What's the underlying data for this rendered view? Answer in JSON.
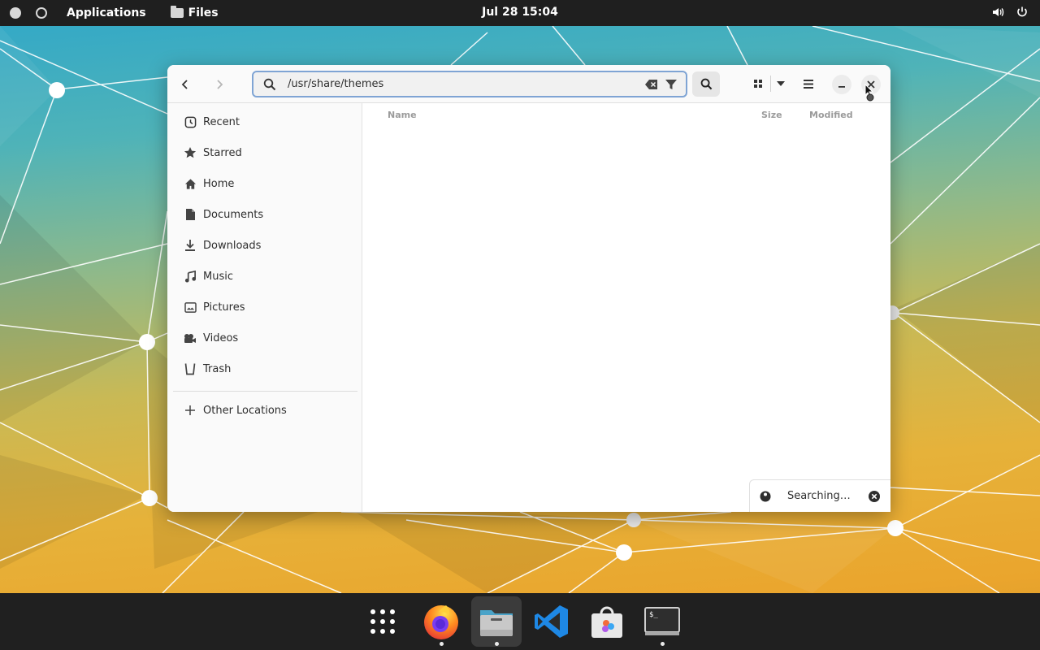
{
  "topbar": {
    "applications_label": "Applications",
    "active_app_label": "Files",
    "clock": "Jul 28  15:04",
    "volume_icon": "speaker-icon",
    "power_icon": "power-icon"
  },
  "window": {
    "location_path": "/usr/share/themes",
    "columns": {
      "name": "Name",
      "size": "Size",
      "modified": "Modified"
    },
    "toast": {
      "text": "Searching…"
    }
  },
  "sidebar": {
    "items": [
      {
        "label": "Recent",
        "icon": "clock-icon"
      },
      {
        "label": "Starred",
        "icon": "star-icon"
      },
      {
        "label": "Home",
        "icon": "home-icon"
      },
      {
        "label": "Documents",
        "icon": "document-icon"
      },
      {
        "label": "Downloads",
        "icon": "download-icon"
      },
      {
        "label": "Music",
        "icon": "music-icon"
      },
      {
        "label": "Pictures",
        "icon": "picture-icon"
      },
      {
        "label": "Videos",
        "icon": "video-icon"
      },
      {
        "label": "Trash",
        "icon": "trash-icon"
      }
    ],
    "other_locations": "Other Locations"
  },
  "dock": {
    "items": [
      "app-grid",
      "firefox",
      "files",
      "vscode",
      "software-store",
      "terminal"
    ]
  },
  "colors": {
    "topbar_bg": "#1f1f1f",
    "dock_bg": "#202020",
    "focus_border": "#7fa4d4"
  }
}
